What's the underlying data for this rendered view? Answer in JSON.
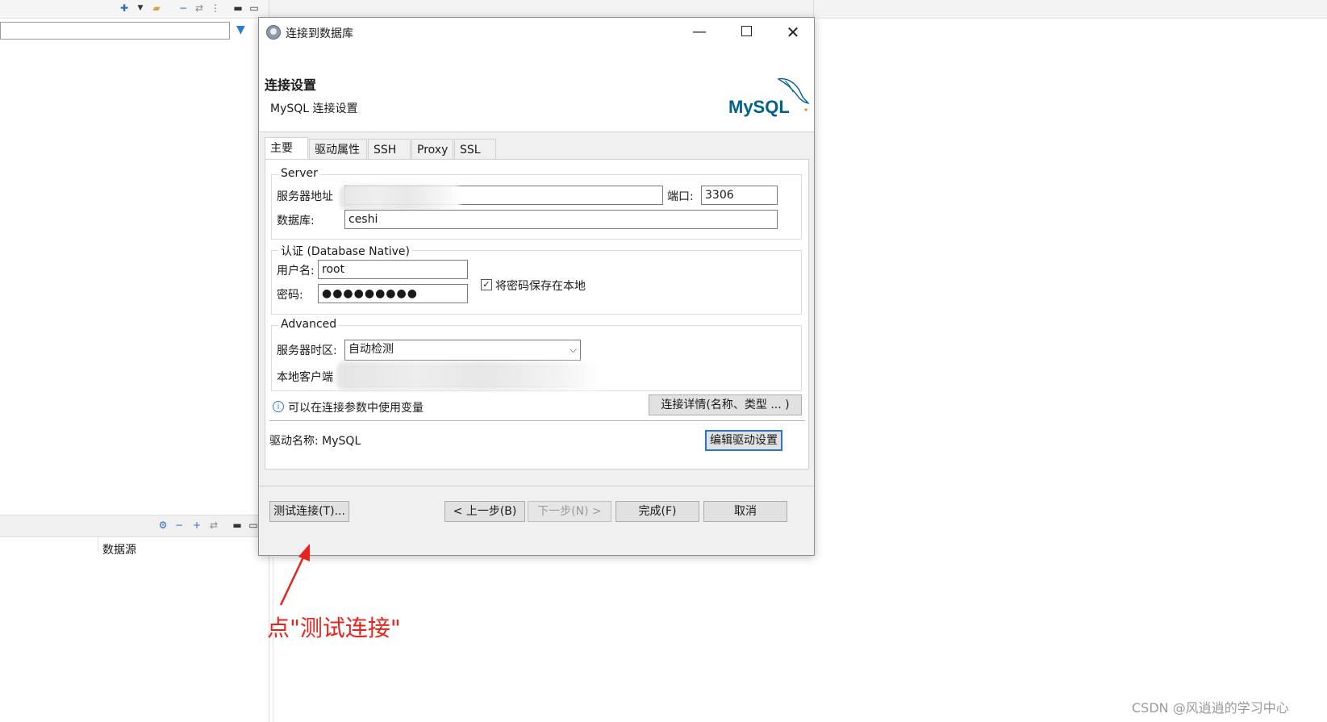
{
  "dialog": {
    "title": "连接到数据库",
    "header_title": "连接设置",
    "header_subtitle": "MySQL 连接设置",
    "logo_text": "MySQL",
    "tabs": [
      {
        "label": "主要",
        "active": true
      },
      {
        "label": "驱动属性",
        "active": false
      },
      {
        "label": "SSH",
        "active": false
      },
      {
        "label": "Proxy",
        "active": false
      },
      {
        "label": "SSL",
        "active": false
      }
    ],
    "server": {
      "group_label": "Server",
      "host_label": "服务器地址",
      "host_value": "",
      "port_label": "端口:",
      "port_value": "3306",
      "database_label": "数据库:",
      "database_value": "ceshi"
    },
    "auth": {
      "group_label": "认证 (Database Native)",
      "username_label": "用户名:",
      "username_value": "root",
      "password_label": "密码:",
      "password_value": "●●●●●●●●●",
      "save_password_label": "将密码保存在本地",
      "save_password_checked": true
    },
    "advanced": {
      "group_label": "Advanced",
      "timezone_label": "服务器时区:",
      "timezone_value": "自动检测",
      "local_client_label": "本地客户端"
    },
    "info_text": "可以在连接参数中使用变量",
    "connection_details_button": "连接详情(名称、类型 ... )",
    "driver_name_label": "驱动名称:",
    "driver_name_value": "MySQL",
    "edit_driver_button": "编辑驱动设置",
    "buttons": {
      "test": "测试连接(T)...",
      "back": "< 上一步(B)",
      "next": "下一步(N) >",
      "finish": "完成(F)",
      "cancel": "取消"
    }
  },
  "background": {
    "datasource_column": "数据源"
  },
  "annotation": {
    "text": "点\"测试连接\""
  },
  "watermark": "CSDN @风逍逍的学习中心",
  "colors": {
    "accent": "#2b75d0",
    "annotation": "#e8231c",
    "mysql_blue": "#00618a",
    "mysql_orange": "#e48e00"
  }
}
